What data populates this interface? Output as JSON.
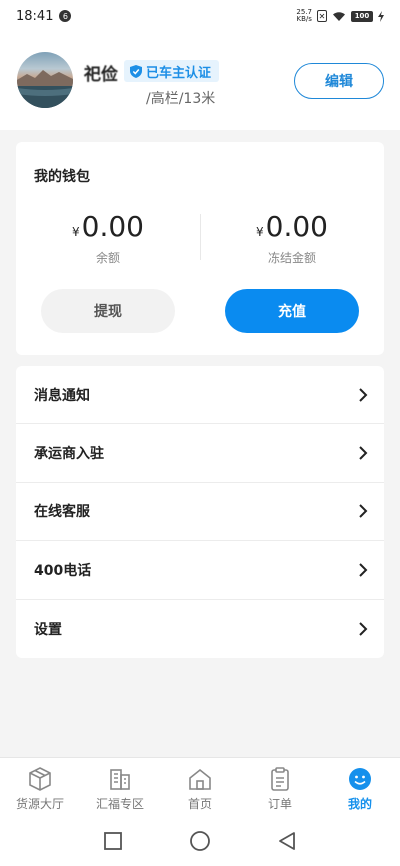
{
  "status_bar": {
    "time": "18:41",
    "notification_count": "6",
    "net_speed_value": "25.7",
    "net_speed_unit": "KB/s",
    "battery": "100"
  },
  "profile": {
    "name": "祀俭",
    "certification": "已车主认证",
    "vehicle": "/高栏/13米",
    "edit_label": "编辑"
  },
  "wallet": {
    "title": "我的钱包",
    "currency_symbol": "¥",
    "balance": "0.00",
    "balance_label": "余额",
    "frozen": "0.00",
    "frozen_label": "冻结金额",
    "withdraw_label": "提现",
    "recharge_label": "充值"
  },
  "menu": {
    "items": [
      {
        "label": "消息通知"
      },
      {
        "label": "承运商入驻"
      },
      {
        "label": "在线客服"
      },
      {
        "label": "400电话"
      },
      {
        "label": "设置"
      }
    ]
  },
  "bottom_nav": {
    "items": [
      {
        "label": "货源大厅",
        "icon": "box-icon"
      },
      {
        "label": "汇福专区",
        "icon": "building-icon"
      },
      {
        "label": "首页",
        "icon": "home-icon"
      },
      {
        "label": "订单",
        "icon": "clipboard-icon"
      },
      {
        "label": "我的",
        "icon": "user-face-icon"
      }
    ],
    "active_index": 4
  },
  "colors": {
    "accent": "#0a8bf0",
    "badge_bg": "#e6f3fd",
    "background": "#f4f4f4"
  }
}
